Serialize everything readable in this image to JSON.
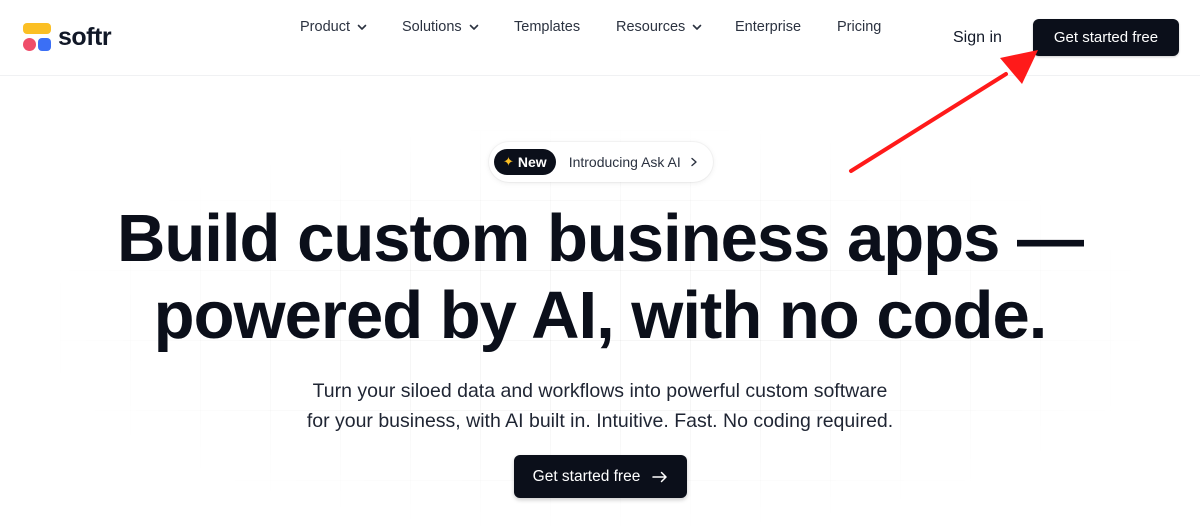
{
  "brand": {
    "name": "softr"
  },
  "nav": {
    "items": [
      {
        "label": "Product",
        "has_dropdown": true
      },
      {
        "label": "Solutions",
        "has_dropdown": true
      },
      {
        "label": "Templates",
        "has_dropdown": false
      },
      {
        "label": "Resources",
        "has_dropdown": true
      },
      {
        "label": "Enterprise",
        "has_dropdown": false
      },
      {
        "label": "Pricing",
        "has_dropdown": false
      }
    ],
    "sign_in": "Sign in",
    "cta": "Get started free"
  },
  "announcement": {
    "badge": "New",
    "badge_icon": "sparkle-icon",
    "text": "Introducing Ask AI"
  },
  "hero": {
    "title_line1": "Build custom business apps —",
    "title_line2": "powered by AI, with no code.",
    "subtitle_line1": "Turn your siloed data and workflows into powerful custom software",
    "subtitle_line2": "for your business, with AI built in. Intuitive. Fast. No coding required.",
    "cta": "Get started free"
  },
  "colors": {
    "primary_dark": "#0b0f1a",
    "logo_yellow": "#fbbf24",
    "logo_pink": "#ef4d6a",
    "logo_blue": "#3b6ff5",
    "annotation_red": "#ff1a1a"
  }
}
